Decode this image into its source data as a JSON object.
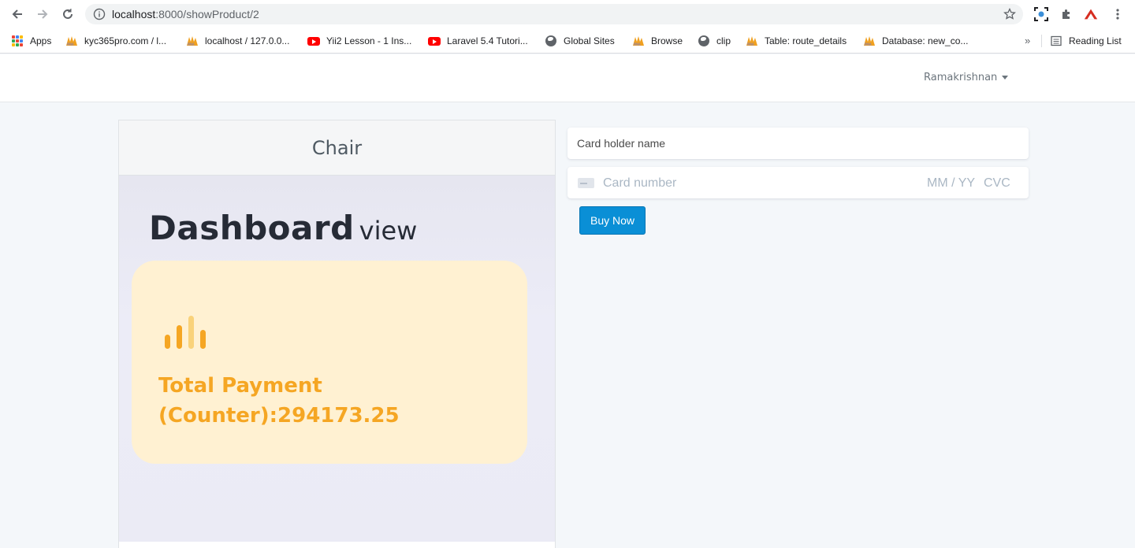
{
  "browser": {
    "url_host": "localhost",
    "url_path": ":8000/showProduct/2",
    "reading_list_label": "Reading List",
    "overflow_label": "»"
  },
  "bookmarks": [
    {
      "label": "Apps",
      "icon": "apps-grid-icon"
    },
    {
      "label": "kyc365pro.com / l...",
      "icon": "phpmyadmin-icon"
    },
    {
      "label": "localhost / 127.0.0...",
      "icon": "phpmyadmin-icon"
    },
    {
      "label": "Yii2 Lesson - 1 Ins...",
      "icon": "youtube-icon"
    },
    {
      "label": "Laravel 5.4 Tutori...",
      "icon": "youtube-icon"
    },
    {
      "label": "Global Sites",
      "icon": "globe-icon"
    },
    {
      "label": "Browse",
      "icon": "phpmyadmin-icon"
    },
    {
      "label": "clip",
      "icon": "globe-icon"
    },
    {
      "label": "Table: route_details",
      "icon": "phpmyadmin-icon"
    },
    {
      "label": "Database: new_co...",
      "icon": "phpmyadmin-icon"
    }
  ],
  "navbar": {
    "user_name": "Ramakrishnan"
  },
  "product": {
    "title": "Chair",
    "image": {
      "heading_bold": "Dashboard",
      "heading_light": "view",
      "payment_text": "Total Payment (Counter):294173.25"
    }
  },
  "payment_form": {
    "card_holder_placeholder": "Card holder name",
    "card_number_placeholder": "Card number",
    "expiry_placeholder": "MM / YY",
    "cvc_placeholder": "CVC",
    "buy_button_label": "Buy Now"
  },
  "colors": {
    "accent_button": "#0a8fd6",
    "payment_card_bg": "#fff1d2",
    "payment_text": "#f5a623",
    "page_bg": "#f4f7fa"
  }
}
